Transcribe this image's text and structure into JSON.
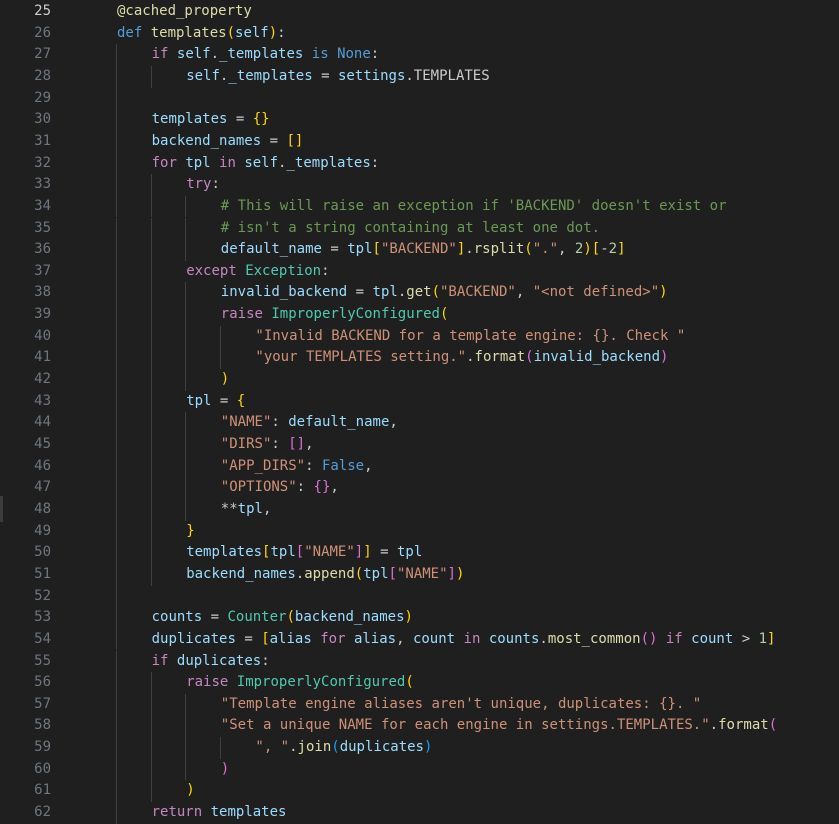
{
  "editor": {
    "active_line": 25,
    "lines": [
      {
        "num": "25",
        "indent": 1,
        "tokens": [
          [
            "f",
            "@cached_property"
          ]
        ]
      },
      {
        "num": "26",
        "indent": 1,
        "tokens": [
          [
            "kd",
            "def "
          ],
          [
            "f",
            "templates"
          ],
          [
            "b1",
            "("
          ],
          [
            "v",
            "self"
          ],
          [
            "b1",
            ")"
          ],
          [
            "p",
            ":"
          ]
        ]
      },
      {
        "num": "27",
        "indent": 2,
        "tokens": [
          [
            "k",
            "if "
          ],
          [
            "v",
            "self"
          ],
          [
            "p",
            "."
          ],
          [
            "v",
            "_templates"
          ],
          [
            "kd",
            " is "
          ],
          [
            "kd",
            "None"
          ],
          [
            "p",
            ":"
          ]
        ]
      },
      {
        "num": "28",
        "indent": 3,
        "tokens": [
          [
            "v",
            "self"
          ],
          [
            "p",
            "."
          ],
          [
            "v",
            "_templates"
          ],
          [
            "p",
            " = "
          ],
          [
            "v",
            "settings"
          ],
          [
            "p",
            ".TEMPLATES"
          ]
        ]
      },
      {
        "num": "29",
        "indent": 0,
        "tokens": []
      },
      {
        "num": "30",
        "indent": 2,
        "tokens": [
          [
            "v",
            "templates"
          ],
          [
            "p",
            " = "
          ],
          [
            "b1",
            "{}"
          ]
        ]
      },
      {
        "num": "31",
        "indent": 2,
        "tokens": [
          [
            "v",
            "backend_names"
          ],
          [
            "p",
            " = "
          ],
          [
            "b1",
            "[]"
          ]
        ]
      },
      {
        "num": "32",
        "indent": 2,
        "tokens": [
          [
            "k",
            "for "
          ],
          [
            "v",
            "tpl"
          ],
          [
            "k",
            " in "
          ],
          [
            "v",
            "self"
          ],
          [
            "p",
            "."
          ],
          [
            "v",
            "_templates"
          ],
          [
            "p",
            ":"
          ]
        ]
      },
      {
        "num": "33",
        "indent": 3,
        "tokens": [
          [
            "k",
            "try"
          ],
          [
            "p",
            ":"
          ]
        ]
      },
      {
        "num": "34",
        "indent": 4,
        "tokens": [
          [
            "cm",
            "# This will raise an exception if 'BACKEND' doesn't exist or"
          ]
        ]
      },
      {
        "num": "35",
        "indent": 4,
        "tokens": [
          [
            "cm",
            "# isn't a string containing at least one dot."
          ]
        ]
      },
      {
        "num": "36",
        "indent": 4,
        "tokens": [
          [
            "v",
            "default_name"
          ],
          [
            "p",
            " = "
          ],
          [
            "v",
            "tpl"
          ],
          [
            "b1",
            "["
          ],
          [
            "s",
            "\"BACKEND\""
          ],
          [
            "b1",
            "]"
          ],
          [
            "p",
            "."
          ],
          [
            "f",
            "rsplit"
          ],
          [
            "b1",
            "("
          ],
          [
            "s",
            "\".\""
          ],
          [
            "p",
            ", "
          ],
          [
            "n",
            "2"
          ],
          [
            "b1",
            ")"
          ],
          [
            "b1",
            "["
          ],
          [
            "p",
            "-"
          ],
          [
            "n",
            "2"
          ],
          [
            "b1",
            "]"
          ]
        ]
      },
      {
        "num": "37",
        "indent": 3,
        "tokens": [
          [
            "k",
            "except "
          ],
          [
            "c",
            "Exception"
          ],
          [
            "p",
            ":"
          ]
        ]
      },
      {
        "num": "38",
        "indent": 4,
        "tokens": [
          [
            "v",
            "invalid_backend"
          ],
          [
            "p",
            " = "
          ],
          [
            "v",
            "tpl"
          ],
          [
            "p",
            "."
          ],
          [
            "f",
            "get"
          ],
          [
            "b1",
            "("
          ],
          [
            "s",
            "\"BACKEND\""
          ],
          [
            "p",
            ", "
          ],
          [
            "s",
            "\"<not defined>\""
          ],
          [
            "b1",
            ")"
          ]
        ]
      },
      {
        "num": "39",
        "indent": 4,
        "tokens": [
          [
            "k",
            "raise "
          ],
          [
            "c",
            "ImproperlyConfigured"
          ],
          [
            "b1",
            "("
          ]
        ]
      },
      {
        "num": "40",
        "indent": 5,
        "tokens": [
          [
            "s",
            "\"Invalid BACKEND for a template engine: {}. Check \""
          ]
        ]
      },
      {
        "num": "41",
        "indent": 5,
        "tokens": [
          [
            "s",
            "\"your TEMPLATES setting.\""
          ],
          [
            "p",
            "."
          ],
          [
            "f",
            "format"
          ],
          [
            "b2",
            "("
          ],
          [
            "v",
            "invalid_backend"
          ],
          [
            "b2",
            ")"
          ]
        ]
      },
      {
        "num": "42",
        "indent": 4,
        "tokens": [
          [
            "b1",
            ")"
          ]
        ]
      },
      {
        "num": "43",
        "indent": 3,
        "tokens": [
          [
            "v",
            "tpl"
          ],
          [
            "p",
            " = "
          ],
          [
            "b1",
            "{"
          ]
        ]
      },
      {
        "num": "44",
        "indent": 4,
        "tokens": [
          [
            "s",
            "\"NAME\""
          ],
          [
            "p",
            ": "
          ],
          [
            "v",
            "default_name"
          ],
          [
            "p",
            ","
          ]
        ]
      },
      {
        "num": "45",
        "indent": 4,
        "tokens": [
          [
            "s",
            "\"DIRS\""
          ],
          [
            "p",
            ": "
          ],
          [
            "b2",
            "[]"
          ],
          [
            "p",
            ","
          ]
        ]
      },
      {
        "num": "46",
        "indent": 4,
        "tokens": [
          [
            "s",
            "\"APP_DIRS\""
          ],
          [
            "p",
            ": "
          ],
          [
            "kd",
            "False"
          ],
          [
            "p",
            ","
          ]
        ]
      },
      {
        "num": "47",
        "indent": 4,
        "tokens": [
          [
            "s",
            "\"OPTIONS\""
          ],
          [
            "p",
            ": "
          ],
          [
            "b2",
            "{}"
          ],
          [
            "p",
            ","
          ]
        ]
      },
      {
        "num": "48",
        "indent": 4,
        "tokens": [
          [
            "p",
            "**"
          ],
          [
            "v",
            "tpl"
          ],
          [
            "p",
            ","
          ]
        ]
      },
      {
        "num": "49",
        "indent": 3,
        "tokens": [
          [
            "b1",
            "}"
          ]
        ]
      },
      {
        "num": "50",
        "indent": 3,
        "tokens": [
          [
            "v",
            "templates"
          ],
          [
            "b1",
            "["
          ],
          [
            "v",
            "tpl"
          ],
          [
            "b2",
            "["
          ],
          [
            "s",
            "\"NAME\""
          ],
          [
            "b2",
            "]"
          ],
          [
            "b1",
            "]"
          ],
          [
            "p",
            " = "
          ],
          [
            "v",
            "tpl"
          ]
        ]
      },
      {
        "num": "51",
        "indent": 3,
        "tokens": [
          [
            "v",
            "backend_names"
          ],
          [
            "p",
            "."
          ],
          [
            "f",
            "append"
          ],
          [
            "b1",
            "("
          ],
          [
            "v",
            "tpl"
          ],
          [
            "b2",
            "["
          ],
          [
            "s",
            "\"NAME\""
          ],
          [
            "b2",
            "]"
          ],
          [
            "b1",
            ")"
          ]
        ]
      },
      {
        "num": "52",
        "indent": 0,
        "tokens": []
      },
      {
        "num": "53",
        "indent": 2,
        "tokens": [
          [
            "v",
            "counts"
          ],
          [
            "p",
            " = "
          ],
          [
            "c",
            "Counter"
          ],
          [
            "b1",
            "("
          ],
          [
            "v",
            "backend_names"
          ],
          [
            "b1",
            ")"
          ]
        ]
      },
      {
        "num": "54",
        "indent": 2,
        "tokens": [
          [
            "v",
            "duplicates"
          ],
          [
            "p",
            " = "
          ],
          [
            "b1",
            "["
          ],
          [
            "v",
            "alias"
          ],
          [
            "k",
            " for "
          ],
          [
            "v",
            "alias"
          ],
          [
            "p",
            ", "
          ],
          [
            "v",
            "count"
          ],
          [
            "k",
            " in "
          ],
          [
            "v",
            "counts"
          ],
          [
            "p",
            "."
          ],
          [
            "f",
            "most_common"
          ],
          [
            "b2",
            "()"
          ],
          [
            "k",
            " if "
          ],
          [
            "v",
            "count"
          ],
          [
            "p",
            " > "
          ],
          [
            "n",
            "1"
          ],
          [
            "b1",
            "]"
          ]
        ]
      },
      {
        "num": "55",
        "indent": 2,
        "tokens": [
          [
            "k",
            "if "
          ],
          [
            "v",
            "duplicates"
          ],
          [
            "p",
            ":"
          ]
        ]
      },
      {
        "num": "56",
        "indent": 3,
        "tokens": [
          [
            "k",
            "raise "
          ],
          [
            "c",
            "ImproperlyConfigured"
          ],
          [
            "b1",
            "("
          ]
        ]
      },
      {
        "num": "57",
        "indent": 4,
        "tokens": [
          [
            "s",
            "\"Template engine aliases aren't unique, duplicates: {}. \""
          ]
        ]
      },
      {
        "num": "58",
        "indent": 4,
        "tokens": [
          [
            "s",
            "\"Set a unique NAME for each engine in settings.TEMPLATES.\""
          ],
          [
            "p",
            "."
          ],
          [
            "f",
            "format"
          ],
          [
            "b2",
            "("
          ]
        ]
      },
      {
        "num": "59",
        "indent": 5,
        "tokens": [
          [
            "s",
            "\", \""
          ],
          [
            "p",
            "."
          ],
          [
            "f",
            "join"
          ],
          [
            "b3",
            "("
          ],
          [
            "v",
            "duplicates"
          ],
          [
            "b3",
            ")"
          ]
        ]
      },
      {
        "num": "60",
        "indent": 4,
        "tokens": [
          [
            "b2",
            ")"
          ]
        ]
      },
      {
        "num": "61",
        "indent": 3,
        "tokens": [
          [
            "b1",
            ")"
          ]
        ]
      },
      {
        "num": "62",
        "indent": 2,
        "tokens": [
          [
            "k",
            "return "
          ],
          [
            "v",
            "templates"
          ]
        ]
      }
    ]
  }
}
